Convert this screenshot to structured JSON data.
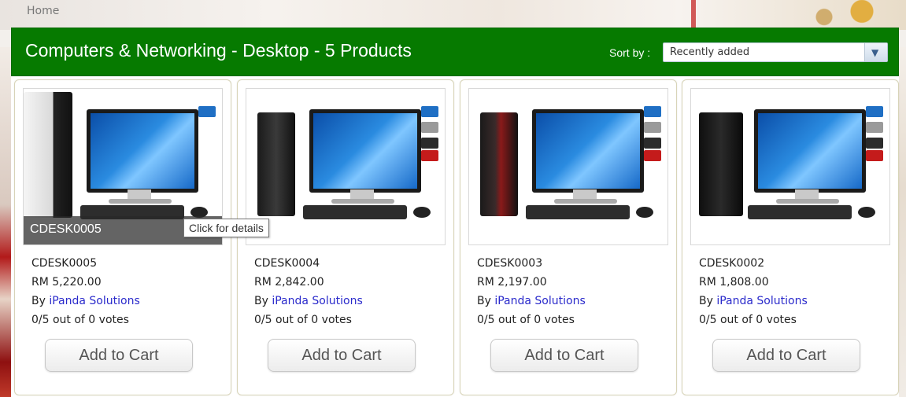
{
  "breadcrumb": {
    "home": "Home"
  },
  "header": {
    "title": "Computers & Networking - Desktop - 5 Products",
    "sort_label": "Sort by :",
    "sort_value": "Recently added"
  },
  "tooltip": "Click for details",
  "products": [
    {
      "code": "CDESK0005",
      "overlay": "CDESK0005",
      "price": "RM 5,220.00",
      "by": "By ",
      "seller": "iPanda Solutions",
      "rating": "0/5 out of 0 votes",
      "cart": "Add to Cart"
    },
    {
      "code": "CDESK0004",
      "price": "RM 2,842.00",
      "by": "By ",
      "seller": "iPanda Solutions",
      "rating": "0/5 out of 0 votes",
      "cart": "Add to Cart"
    },
    {
      "code": "CDESK0003",
      "price": "RM 2,197.00",
      "by": "By ",
      "seller": "iPanda Solutions",
      "rating": "0/5 out of 0 votes",
      "cart": "Add to Cart"
    },
    {
      "code": "CDESK0002",
      "price": "RM 1,808.00",
      "by": "By ",
      "seller": "iPanda Solutions",
      "rating": "0/5 out of 0 votes",
      "cart": "Add to Cart"
    }
  ],
  "colors": {
    "header_bg": "#067a00",
    "link": "#2a2acb"
  },
  "icons": {
    "sort_dropdown": "chevron-down-icon"
  }
}
